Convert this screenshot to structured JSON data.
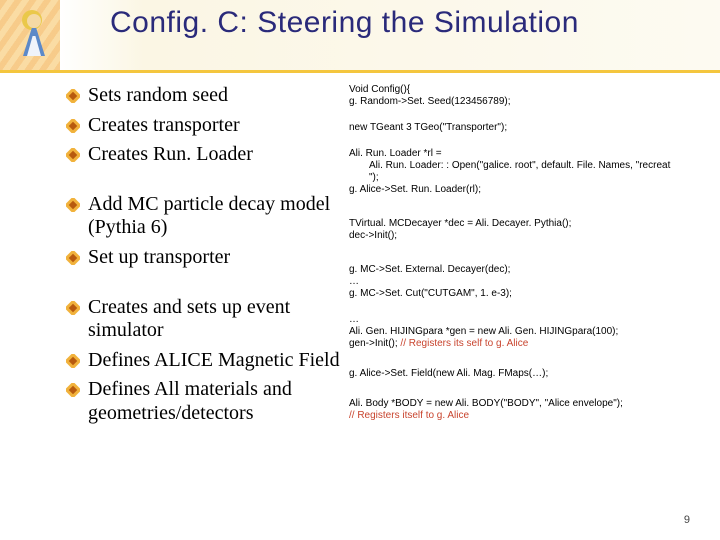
{
  "title": "Config. C: Steering the Simulation",
  "page_number": "9",
  "bullets": [
    "Sets random seed",
    "Creates transporter",
    "Creates Run. Loader",
    "Add MC particle decay model (Pythia 6)",
    "Set up transporter",
    "Creates and sets up event simulator",
    "Defines ALICE Magnetic Field",
    "Defines All materials and geometries/detectors"
  ],
  "code": {
    "b1": {
      "l1": "Void Config(){",
      "l2": "g. Random->Set. Seed(123456789);"
    },
    "b2": {
      "l1": "new TGeant 3 TGeo(\"Transporter\");"
    },
    "b3": {
      "l1": "Ali. Run. Loader *rl =",
      "l2": "Ali. Run. Loader: : Open(\"galice. root\", default. File. Names, \"recreat",
      "l3": "\");",
      "l4": "g. Alice->Set. Run. Loader(rl);"
    },
    "b4": {
      "l1": "TVirtual. MCDecayer *dec = Ali. Decayer. Pythia();",
      "l2": "dec->Init();"
    },
    "b5": {
      "l1": "g. MC->Set. External. Decayer(dec);",
      "l2": "…",
      "l3": "g. MC->Set. Cut(\"CUTGAM\", 1. e-3);"
    },
    "b6": {
      "l1": "…",
      "l2": "Ali. Gen. HIJINGpara *gen = new Ali. Gen. HIJINGpara(100);",
      "l3a": "gen->Init(); ",
      "l3b": "// Registers its self to g. Alice"
    },
    "b7": {
      "l1": "g. Alice->Set. Field(new Ali. Mag. FMaps(…);"
    },
    "b8": {
      "l1": "Ali. Body *BODY = new Ali. BODY(\"BODY\", \"Alice envelope\");",
      "l2": "// Registers itself to g. Alice"
    }
  }
}
